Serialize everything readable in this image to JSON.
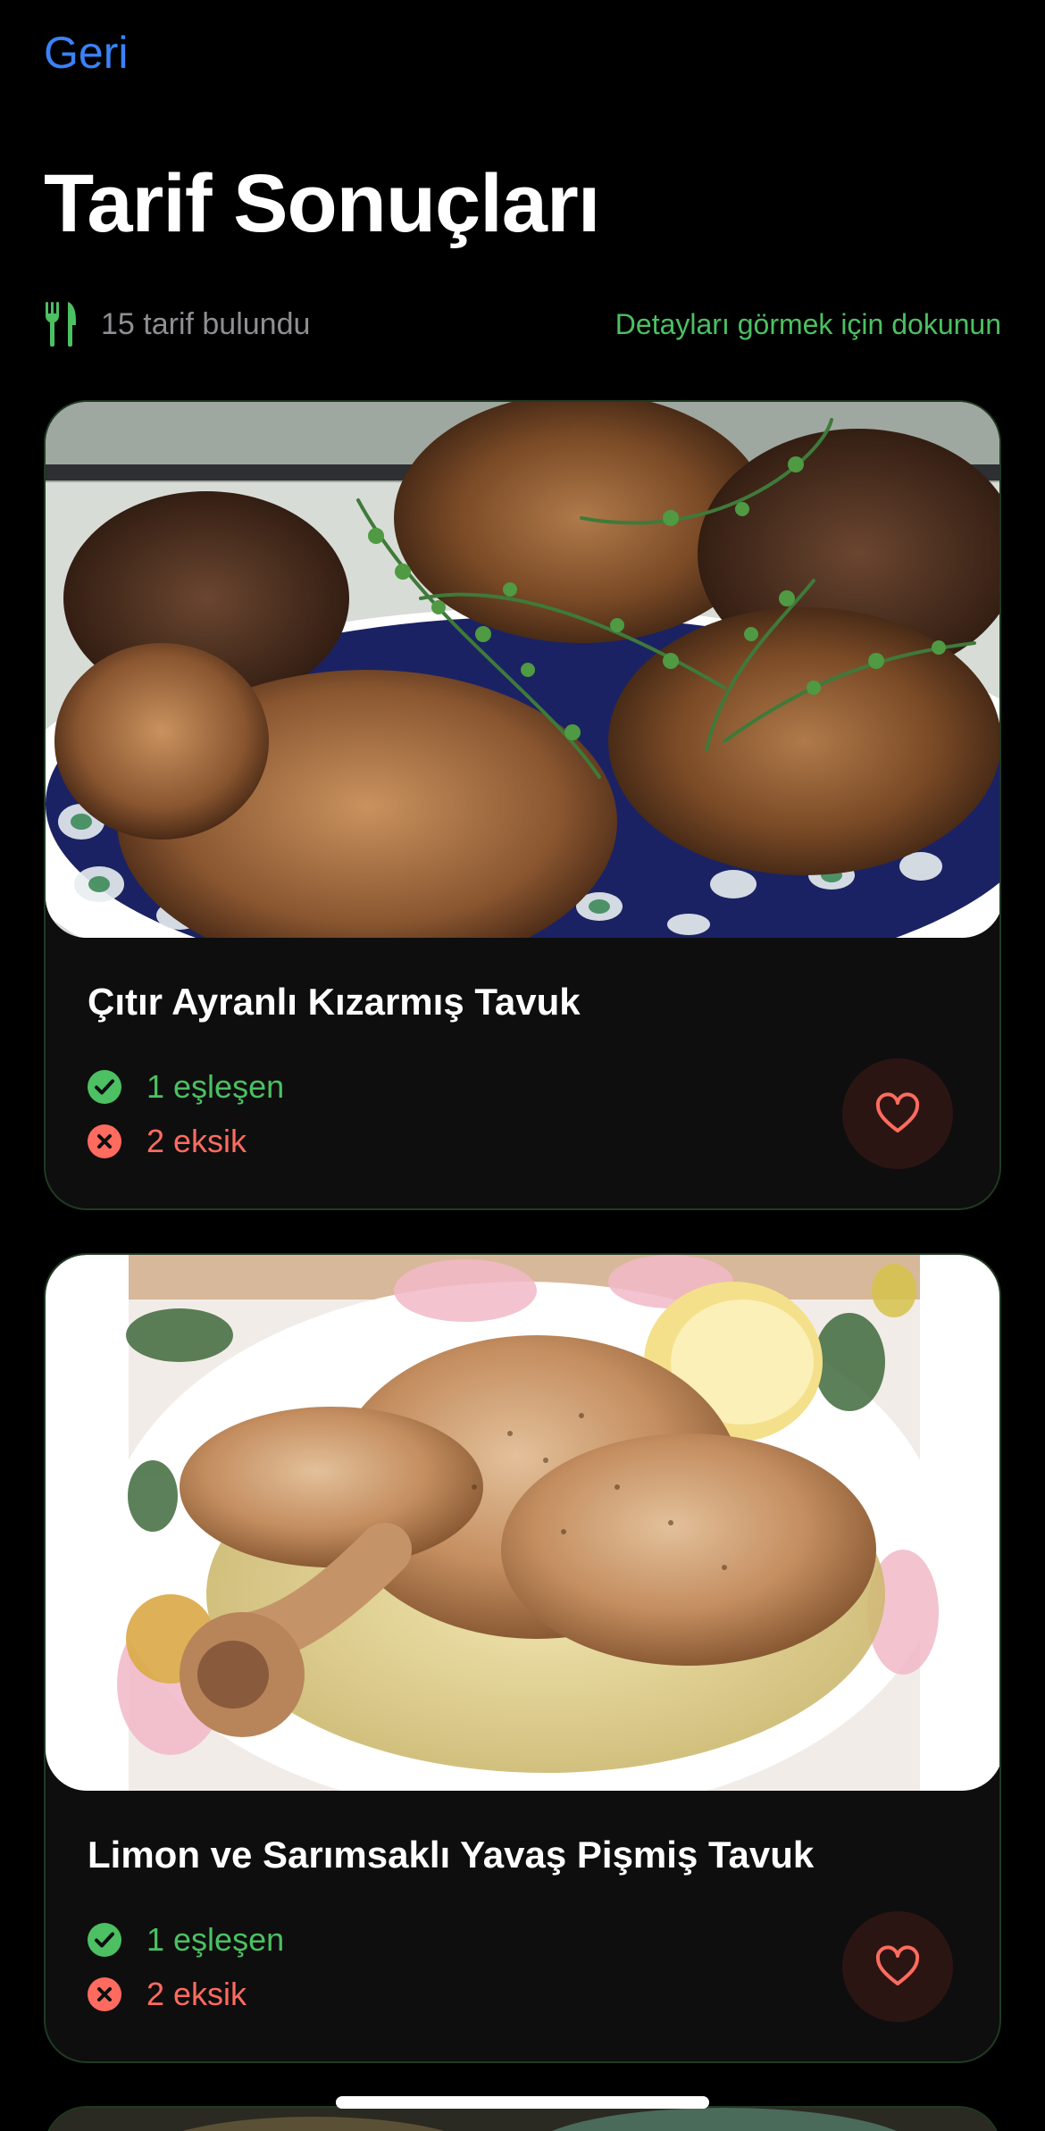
{
  "nav": {
    "back_label": "Geri"
  },
  "page": {
    "title": "Tarif Sonuçları"
  },
  "summary": {
    "icon": "fork-knife-icon",
    "count_text": "15 tarif bulundu",
    "hint_text": "Detayları görmek için dokunun"
  },
  "colors": {
    "accent_green": "#4cc062",
    "missing_red": "#ff6b5f",
    "link_blue": "#3a82f7",
    "favorite_bg": "#2b1513"
  },
  "recipes": [
    {
      "title": "Çıtır Ayranlı Kızarmış Tavuk",
      "matched_text": "1 eşleşen",
      "missing_text": "2 eksik",
      "image": "fried-chicken-photo",
      "favorite_icon": "heart-icon"
    },
    {
      "title": "Limon ve Sarımsaklı Yavaş Pişmiş Tavuk",
      "matched_text": "1 eşleşen",
      "missing_text": "2 eksik",
      "image": "roast-chicken-photo",
      "favorite_icon": "heart-icon"
    }
  ]
}
